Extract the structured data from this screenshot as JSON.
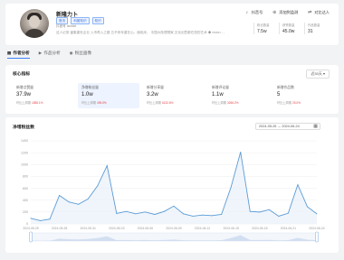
{
  "profile": {
    "name": "新隆力卜",
    "tags": [
      "首页",
      "科普知识",
      "知识"
    ],
    "meta": "抖音号 lanhlet",
    "desc": "这人记录 逢集重世企业 入市再入之路 五不来年重在心。面临未、 中国大陆理想家,文化创意都在拍的艺术 ◆ vision... 展开",
    "actions": [
      {
        "label": "抖音号",
        "icon": "tiktok-icon"
      },
      {
        "label": "添加到监测",
        "icon": "monitor-icon"
      },
      {
        "label": "对比达人",
        "icon": "compare-icon"
      }
    ],
    "stats": [
      {
        "label": "粉丝数量",
        "value": "7.5w"
      },
      {
        "label": "获赞数量",
        "value": "45.0w"
      },
      {
        "label": "作品数量",
        "value": "31"
      }
    ]
  },
  "tabs": [
    {
      "label": "作者分析",
      "icon": "chart-icon"
    },
    {
      "label": "作品分析",
      "icon": "video-icon"
    },
    {
      "label": "粉丝画像",
      "icon": "user-icon"
    }
  ],
  "metrics": {
    "title": "核心指标",
    "period": "近30天 ▾",
    "items": [
      {
        "label": "新增点赞量",
        "value": "37.9w",
        "compare_label": "环比上周期",
        "change": "1858.1%"
      },
      {
        "label": "净增粉丝量",
        "value": "1.0w",
        "compare_label": "环比上周期",
        "change": "495.5%"
      },
      {
        "label": "新增分享量",
        "value": "3.2w",
        "compare_label": "环比上周期",
        "change": "6132.6%"
      },
      {
        "label": "新增评论量",
        "value": "1.1w",
        "compare_label": "环比上周期",
        "change": "3266.2%"
      },
      {
        "label": "新增作品数",
        "value": "5",
        "compare_label": "环比上周期",
        "change": "25.0%"
      }
    ]
  },
  "chart_section": {
    "title": "净增粉丝数",
    "date_range": "2024-05-25 → 2024-06-24"
  },
  "chart_data": {
    "type": "area",
    "title": "净增粉丝数",
    "xlabel": "",
    "ylabel": "",
    "ylim": [
      0,
      1400
    ],
    "yticks": [
      0,
      200,
      400,
      600,
      800,
      1000,
      1200,
      1400
    ],
    "x": [
      "2024-05-25",
      "2024-05-26",
      "2024-05-27",
      "2024-05-28",
      "2024-05-29",
      "2024-05-30",
      "2024-05-31",
      "2024-06-01",
      "2024-06-02",
      "2024-06-03",
      "2024-06-04",
      "2024-06-05",
      "2024-06-06",
      "2024-06-07",
      "2024-06-08",
      "2024-06-09",
      "2024-06-10",
      "2024-06-11",
      "2024-06-12",
      "2024-06-13",
      "2024-06-14",
      "2024-06-15",
      "2024-06-16",
      "2024-06-17",
      "2024-06-18",
      "2024-06-19",
      "2024-06-20",
      "2024-06-21",
      "2024-06-22",
      "2024-06-23",
      "2024-06-24"
    ],
    "xtick_labels": [
      "2024-05-25",
      "2024-05-28",
      "2024-05-31",
      "2024-06-03",
      "2024-06-06",
      "2024-06-09",
      "2024-06-12",
      "2024-06-15",
      "2024-06-18",
      "2024-06-21",
      "2024-06-24"
    ],
    "series": [
      {
        "values": [
          95,
          55,
          80,
          480,
          370,
          330,
          420,
          640,
          980,
          175,
          210,
          170,
          200,
          160,
          210,
          300,
          170,
          130,
          150,
          140,
          160,
          620,
          1210,
          210,
          200,
          240,
          130,
          180,
          660,
          290,
          170
        ]
      }
    ],
    "grid": true,
    "legend": "none",
    "line_color": "#5b9bd5",
    "fill_color": "#e3edf9"
  }
}
